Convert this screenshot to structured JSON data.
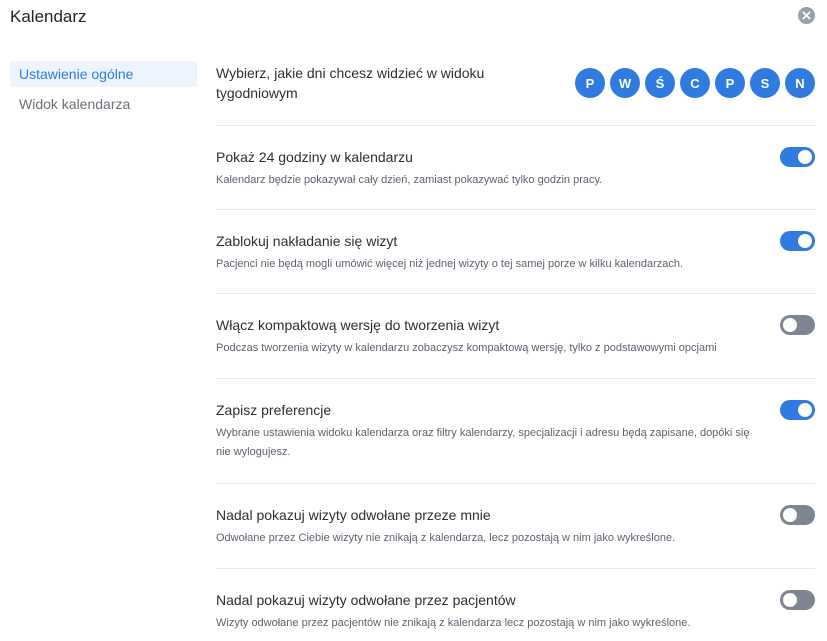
{
  "window": {
    "title": "Kalendarz"
  },
  "sidebar": {
    "items": [
      {
        "label": "Ustawienie ogólne",
        "active": true
      },
      {
        "label": "Widok kalendarza",
        "active": false
      }
    ]
  },
  "days": {
    "label": "Wybierz, jakie dni chcesz widzieć w widoku tygodniowym",
    "items": [
      "P",
      "W",
      "Ś",
      "C",
      "P",
      "S",
      "N"
    ],
    "accent": "#2f7be0"
  },
  "settings": [
    {
      "title": "Pokaż 24 godziny w kalendarzu",
      "desc": "Kalendarz będzie pokazywał cały dzień, zamiast pokazywać tylko godzin pracy.",
      "enabled": true
    },
    {
      "title": "Zablokuj nakładanie się wizyt",
      "desc": "Pacjenci nie będą mogli umówić więcej niż jednej wizyty o tej samej porze w kilku kalendarzach.",
      "enabled": true
    },
    {
      "title": "Włącz kompaktową wersję do tworzenia wizyt",
      "desc": "Podczas tworzenia wizyty w kalendarzu zobaczysz kompaktową wersję, tylko z podstawowymi opcjami",
      "enabled": false
    },
    {
      "title": "Zapisz preferencje",
      "desc": "Wybrane ustawienia widoku kalendarza oraz filtry kalendarzy, specjalizacji i adresu będą zapisane, dopóki się nie wylogujesz.",
      "enabled": true
    },
    {
      "title": "Nadal pokazuj wizyty odwołane przeze mnie",
      "desc": "Odwołane przez Ciebie wizyty nie znikają z kalendarza, lecz pozostają w nim jako wykreślone.",
      "enabled": false
    },
    {
      "title": "Nadal pokazuj wizyty odwołane przez pacjentów",
      "desc": "Wizyty odwołane przez pacjentów nie znikają z kalendarza lecz pozostają w nim jako wykreślone.",
      "enabled": false
    }
  ],
  "colors": {
    "accent": "#2f7be0",
    "toggle_off": "#7d8590",
    "divider": "#e7e9ec"
  }
}
